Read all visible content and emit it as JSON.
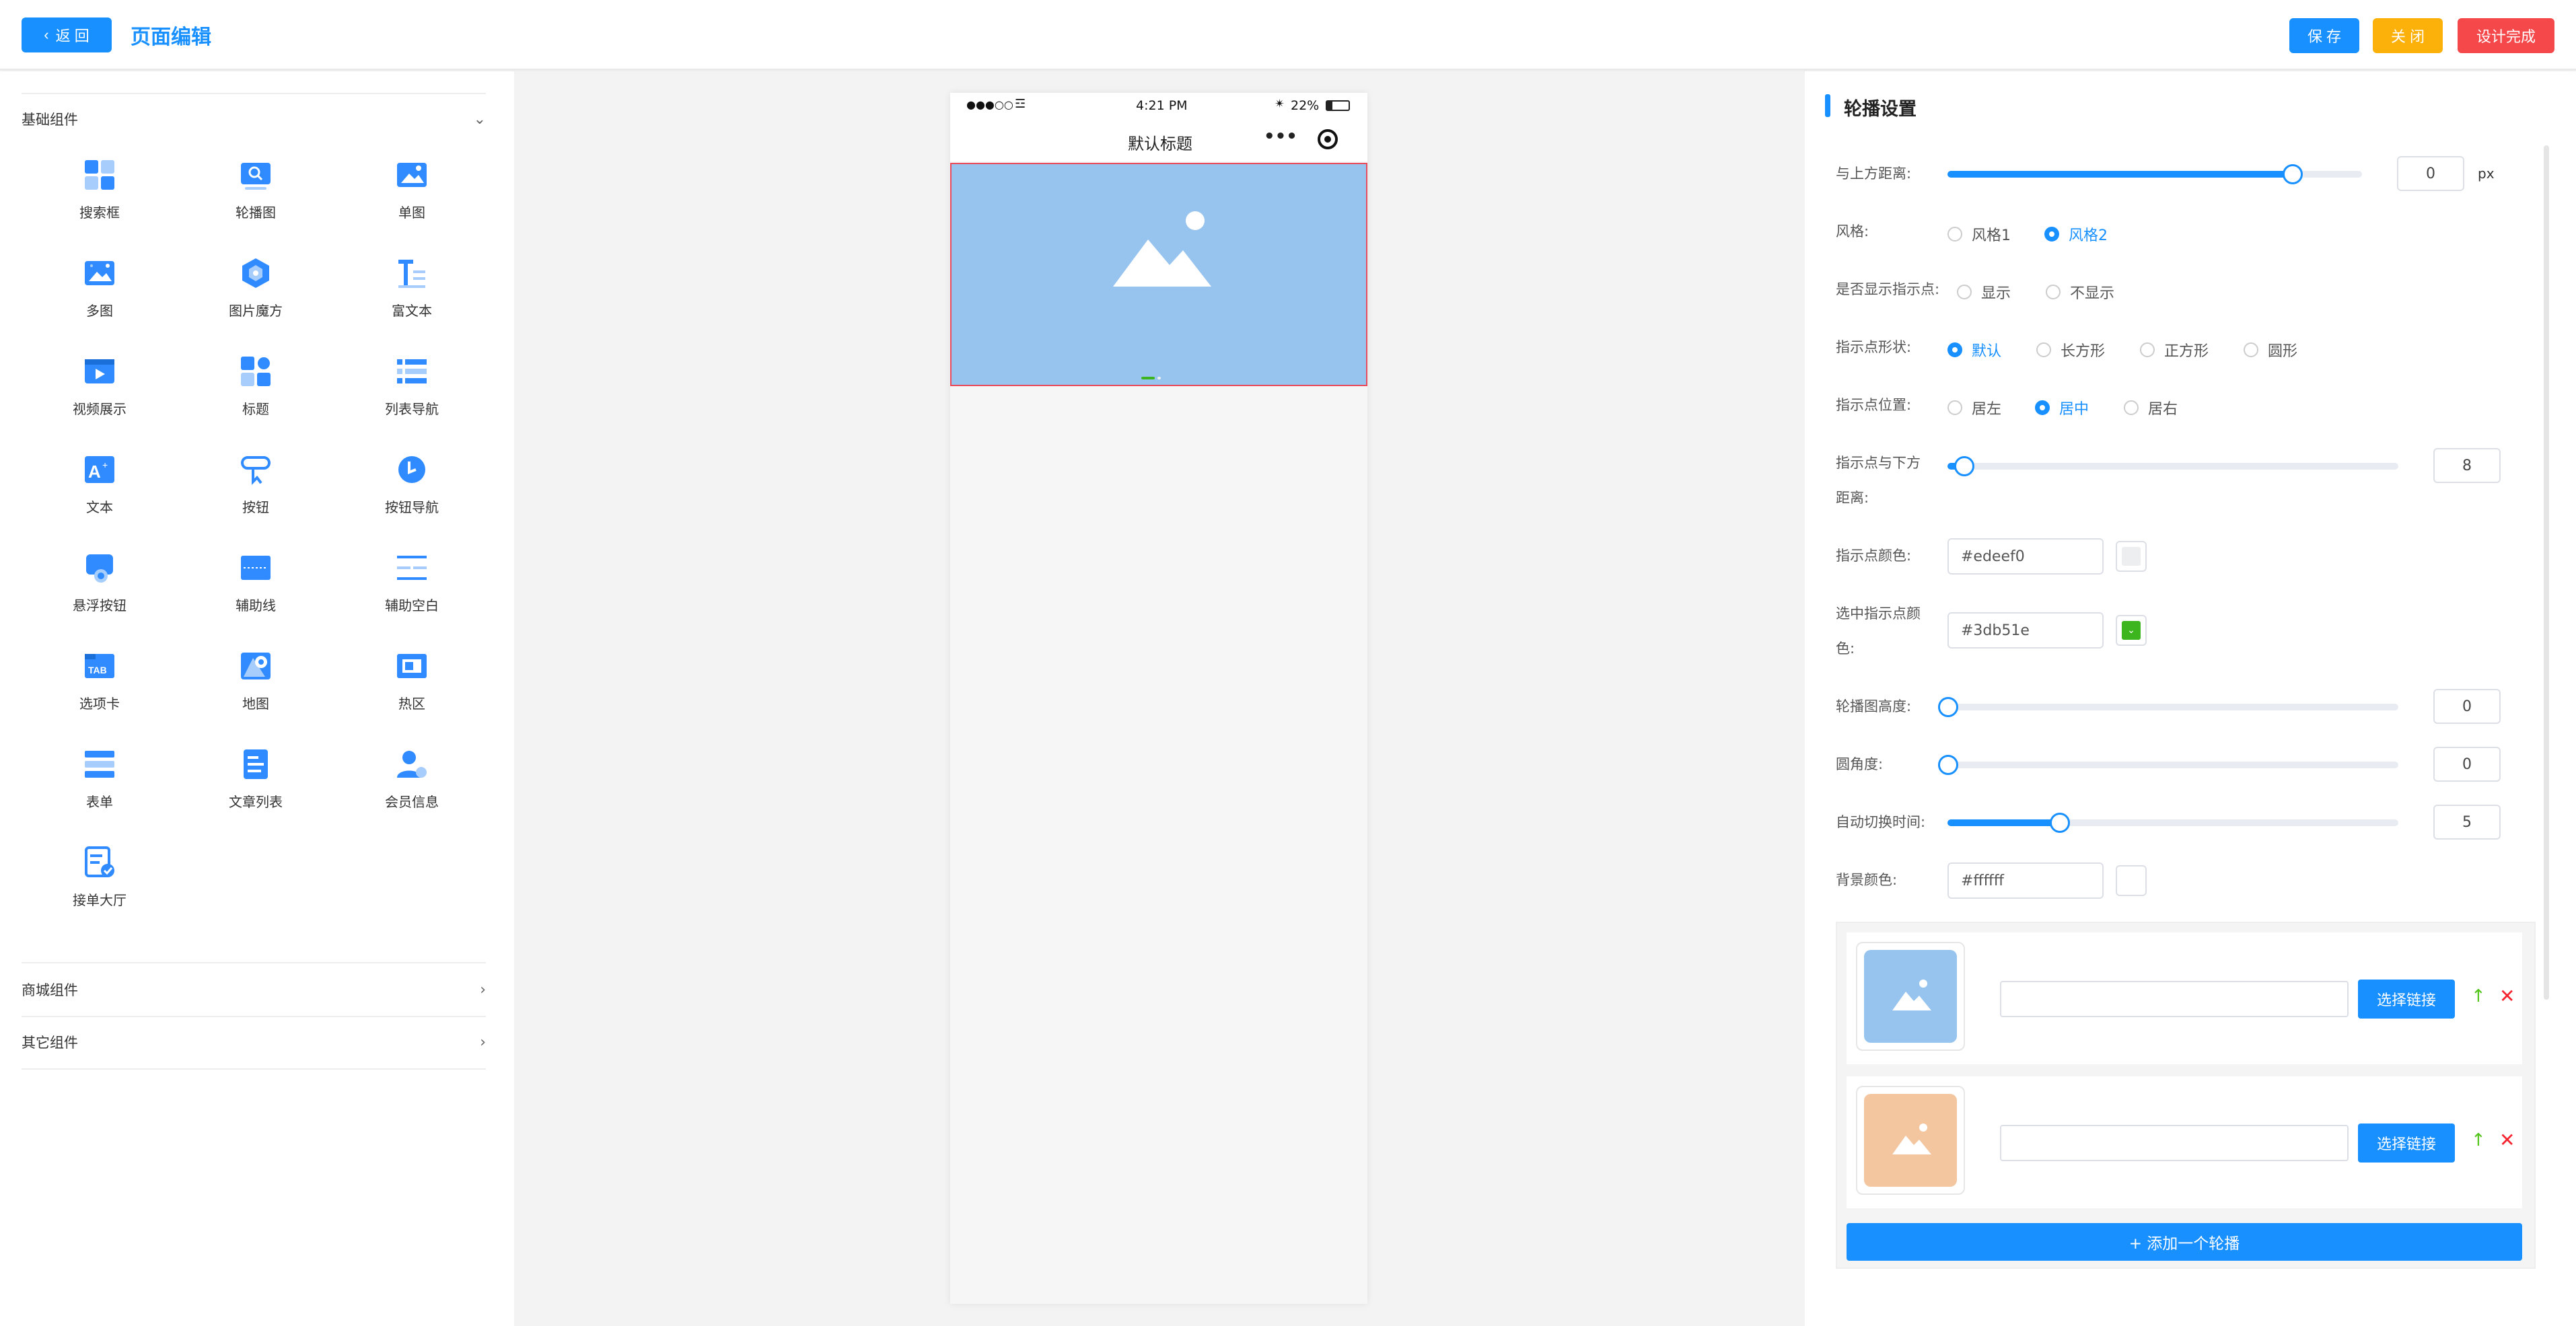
{
  "header": {
    "back_label": "返 回",
    "page_title": "页面编辑",
    "save_label": "保 存",
    "close_label": "关 闭",
    "done_label": "设计完成"
  },
  "left_panel": {
    "sections": [
      {
        "title": "基础组件",
        "expanded": true
      },
      {
        "title": "商城组件",
        "expanded": false
      },
      {
        "title": "其它组件",
        "expanded": false
      }
    ],
    "components": [
      {
        "label": "搜索框",
        "icon": "search-box-icon"
      },
      {
        "label": "轮播图",
        "icon": "carousel-icon"
      },
      {
        "label": "单图",
        "icon": "single-image-icon"
      },
      {
        "label": "多图",
        "icon": "multi-image-icon"
      },
      {
        "label": "图片魔方",
        "icon": "image-cube-icon"
      },
      {
        "label": "富文本",
        "icon": "rich-text-icon"
      },
      {
        "label": "视频展示",
        "icon": "video-icon"
      },
      {
        "label": "标题",
        "icon": "title-icon"
      },
      {
        "label": "列表导航",
        "icon": "list-nav-icon"
      },
      {
        "label": "文本",
        "icon": "text-icon"
      },
      {
        "label": "按钮",
        "icon": "button-icon"
      },
      {
        "label": "按钮导航",
        "icon": "button-nav-icon"
      },
      {
        "label": "悬浮按钮",
        "icon": "float-button-icon"
      },
      {
        "label": "辅助线",
        "icon": "guide-line-icon"
      },
      {
        "label": "辅助空白",
        "icon": "blank-space-icon"
      },
      {
        "label": "选项卡",
        "icon": "tab-icon"
      },
      {
        "label": "地图",
        "icon": "map-icon"
      },
      {
        "label": "热区",
        "icon": "hotspot-icon"
      },
      {
        "label": "表单",
        "icon": "form-icon"
      },
      {
        "label": "文章列表",
        "icon": "article-list-icon"
      },
      {
        "label": "会员信息",
        "icon": "member-info-icon"
      },
      {
        "label": "接单大厅",
        "icon": "order-hall-icon"
      }
    ]
  },
  "phone": {
    "status_signal": "●●●○○",
    "status_time": "4:21 PM",
    "status_battery": "22%",
    "nav_title": "默认标题",
    "banner_color": "#97c4ef"
  },
  "right_panel": {
    "title": "轮播设置",
    "top_distance": {
      "label": "与上方距离:",
      "value": "0",
      "unit": "px",
      "level": 0.83
    },
    "style": {
      "label": "风格:",
      "options": [
        "风格1",
        "风格2"
      ],
      "selected": 1
    },
    "show_dots": {
      "label": "是否显示指示点:",
      "options": [
        "显示",
        "不显示"
      ],
      "selected": -1
    },
    "dot_shape": {
      "label": "指示点形状:",
      "options": [
        "默认",
        "长方形",
        "正方形",
        "圆形"
      ],
      "selected": 0
    },
    "dot_position": {
      "label": "指示点位置:",
      "options": [
        "居左",
        "居中",
        "居右"
      ],
      "selected": 1
    },
    "dot_bottom": {
      "label_line1": "指示点与下方",
      "label_line2": "距离:",
      "value": "8",
      "level": 0.04
    },
    "dot_color": {
      "label": "指示点颜色:",
      "value": "#edeef0"
    },
    "active_dot_color": {
      "label_line1": "选中指示点颜",
      "label_line2": "色:",
      "value": "#3db51e"
    },
    "carousel_height": {
      "label": "轮播图高度:",
      "value": "0",
      "level": 0
    },
    "radius": {
      "label": "圆角度:",
      "value": "0",
      "level": 0
    },
    "interval": {
      "label": "自动切换时间:",
      "value": "5",
      "level": 0.25
    },
    "bg_color": {
      "label": "背景颜色:",
      "value": "#ffffff"
    },
    "items": [
      {
        "thumb_color": "#97c4ef",
        "link_label": "选择链接",
        "link_value": ""
      },
      {
        "thumb_color": "#f3c6a0",
        "link_label": "选择链接",
        "link_value": ""
      }
    ],
    "add_label": "+ 添加一个轮播"
  }
}
